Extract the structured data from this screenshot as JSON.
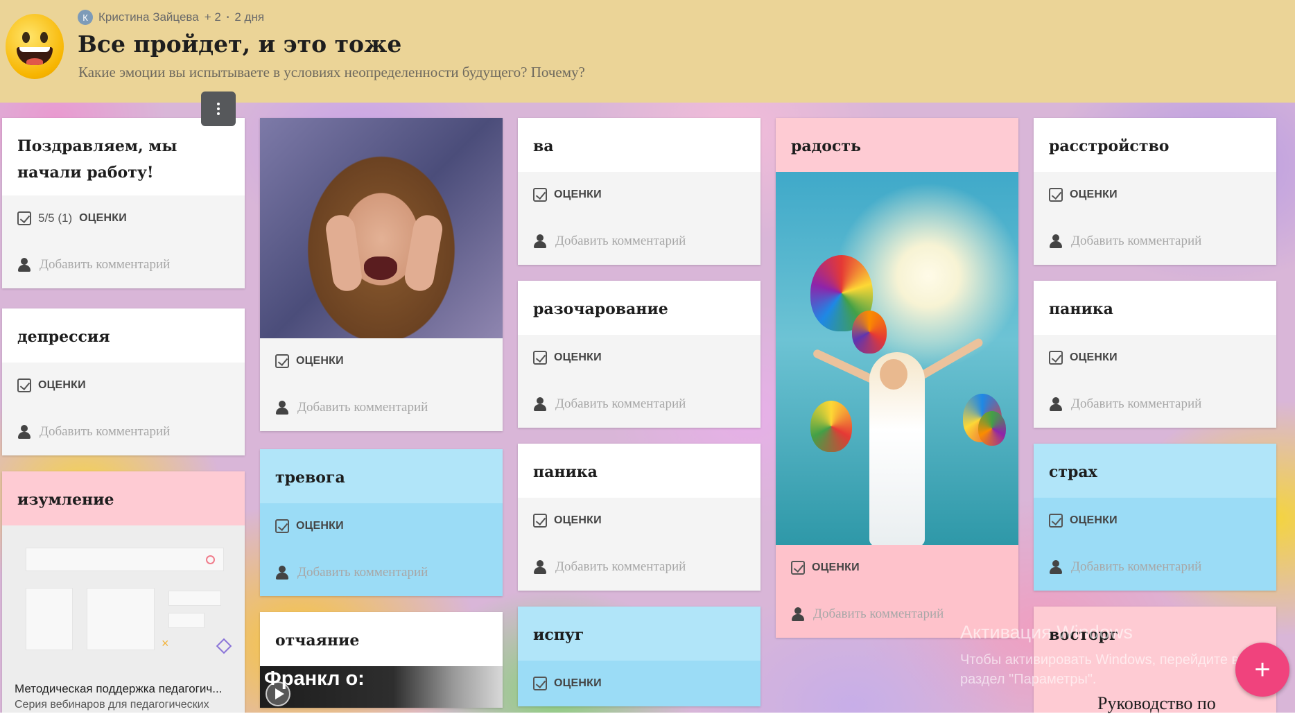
{
  "header": {
    "author_initial": "К",
    "author": "Кристина Зайцева",
    "plus_count": "+ 2",
    "time_ago": "2 дня",
    "title": "Все пройдет, и это тоже",
    "subtitle": "Какие эмоции вы испытываете в условиях неопределенности будущего? Почему?"
  },
  "labels": {
    "ratings": "ОЦЕНКИ",
    "add_comment": "Добавить комментарий"
  },
  "cards": {
    "congrats": {
      "title": "Поздравляем, мы начали работу!",
      "score": "5/5 (1)"
    },
    "depression": {
      "title": "депрессия"
    },
    "amazement": {
      "title": "изумление",
      "link_title": "Методическая поддержка педагогич...",
      "link_sub": "Серия вебинаров для педагогических"
    },
    "woman_photo": {},
    "anxiety": {
      "title": "тревога"
    },
    "despair": {
      "title": "отчаяние",
      "video_text": "Франкл о:"
    },
    "va": {
      "title": "ва"
    },
    "disappointment": {
      "title": "разочарование"
    },
    "panic1": {
      "title": "паника"
    },
    "fright": {
      "title": "испуг"
    },
    "joy": {
      "title": "радость"
    },
    "frustration": {
      "title": "расстройство"
    },
    "panic2": {
      "title": "паника"
    },
    "fear": {
      "title": "страх"
    },
    "delight": {
      "title": "восторг"
    }
  },
  "watermark": {
    "line1": "Активация Windows",
    "line2": "Чтобы активировать Windows, перейдите в",
    "line3": "раздел \"Параметры\"."
  },
  "fab_label": "+",
  "guide_text": "Руководство по"
}
